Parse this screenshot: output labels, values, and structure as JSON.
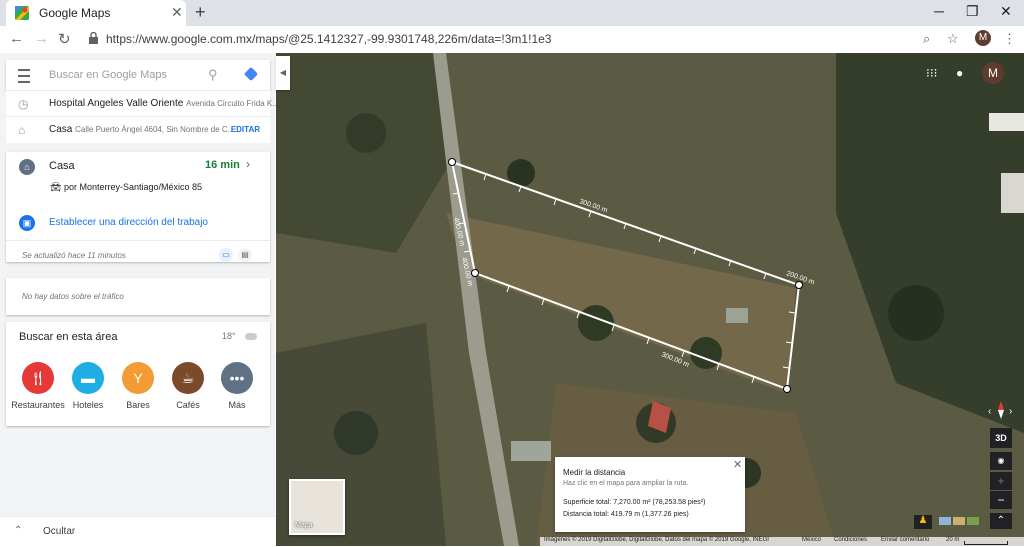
{
  "browser": {
    "tab_title": "Google Maps",
    "url": "https://www.google.com.mx/maps/@25.1412327,-99.9301748,226m/data=!3m1!1e3",
    "profile_initial": "M"
  },
  "search": {
    "placeholder": "Buscar en Google Maps"
  },
  "saved_places": [
    {
      "name": "Hospital Angeles Valle Oriente",
      "address": "Avenida Circuito Frida K..."
    },
    {
      "name": "Casa",
      "address": "Calle Puerto Ángel 4604, Sin Nombre de C...",
      "action": "EDITAR"
    }
  ],
  "commute": {
    "destination": "Casa",
    "duration": "16 min",
    "route": "por Monterrey-Santiago/México 85",
    "work_link": "Establecer una dirección del trabajo",
    "updated": "Se actualizó hace 11 minutos"
  },
  "traffic": {
    "message": "No hay datos sobre el tráfico"
  },
  "area": {
    "title": "Buscar en esta área",
    "temperature": "18°",
    "categories": [
      {
        "label": "Restaurantes",
        "icon": "restaurant-icon",
        "color": "#e53935"
      },
      {
        "label": "Hoteles",
        "icon": "hotel-icon",
        "color": "#1eaee3"
      },
      {
        "label": "Bares",
        "icon": "bar-icon",
        "color": "#f39c34"
      },
      {
        "label": "Cafés",
        "icon": "cafe-icon",
        "color": "#7b4a2b"
      },
      {
        "label": "Más",
        "icon": "more-icon",
        "color": "#5e7185"
      }
    ]
  },
  "panel": {
    "hide_label": "Ocultar"
  },
  "map": {
    "avatar_initial": "M",
    "labels": [
      "300.00 m",
      "200.00 m",
      "300.00 m",
      "400.00 m",
      "400.00 m"
    ],
    "measure": {
      "title": "Medir la distancia",
      "hint": "Haz clic en el mapa para ampliar la ruta.",
      "area": "Superficie total: 7,270.00 m² (78,253.58 pies²)",
      "distance": "Distancia total: 419.79 m (1,377.26 pies)"
    },
    "thumbnail_label": "Mapa",
    "control_3d": "3D",
    "footer": {
      "imagery": "Imágenes © 2019 DigitalGlobe, DigitalGlobe, Datos del mapa © 2019 Google, INEGI",
      "country": "México",
      "terms": "Condiciones",
      "feedback": "Enviar comentario",
      "scale": "20 m"
    }
  }
}
